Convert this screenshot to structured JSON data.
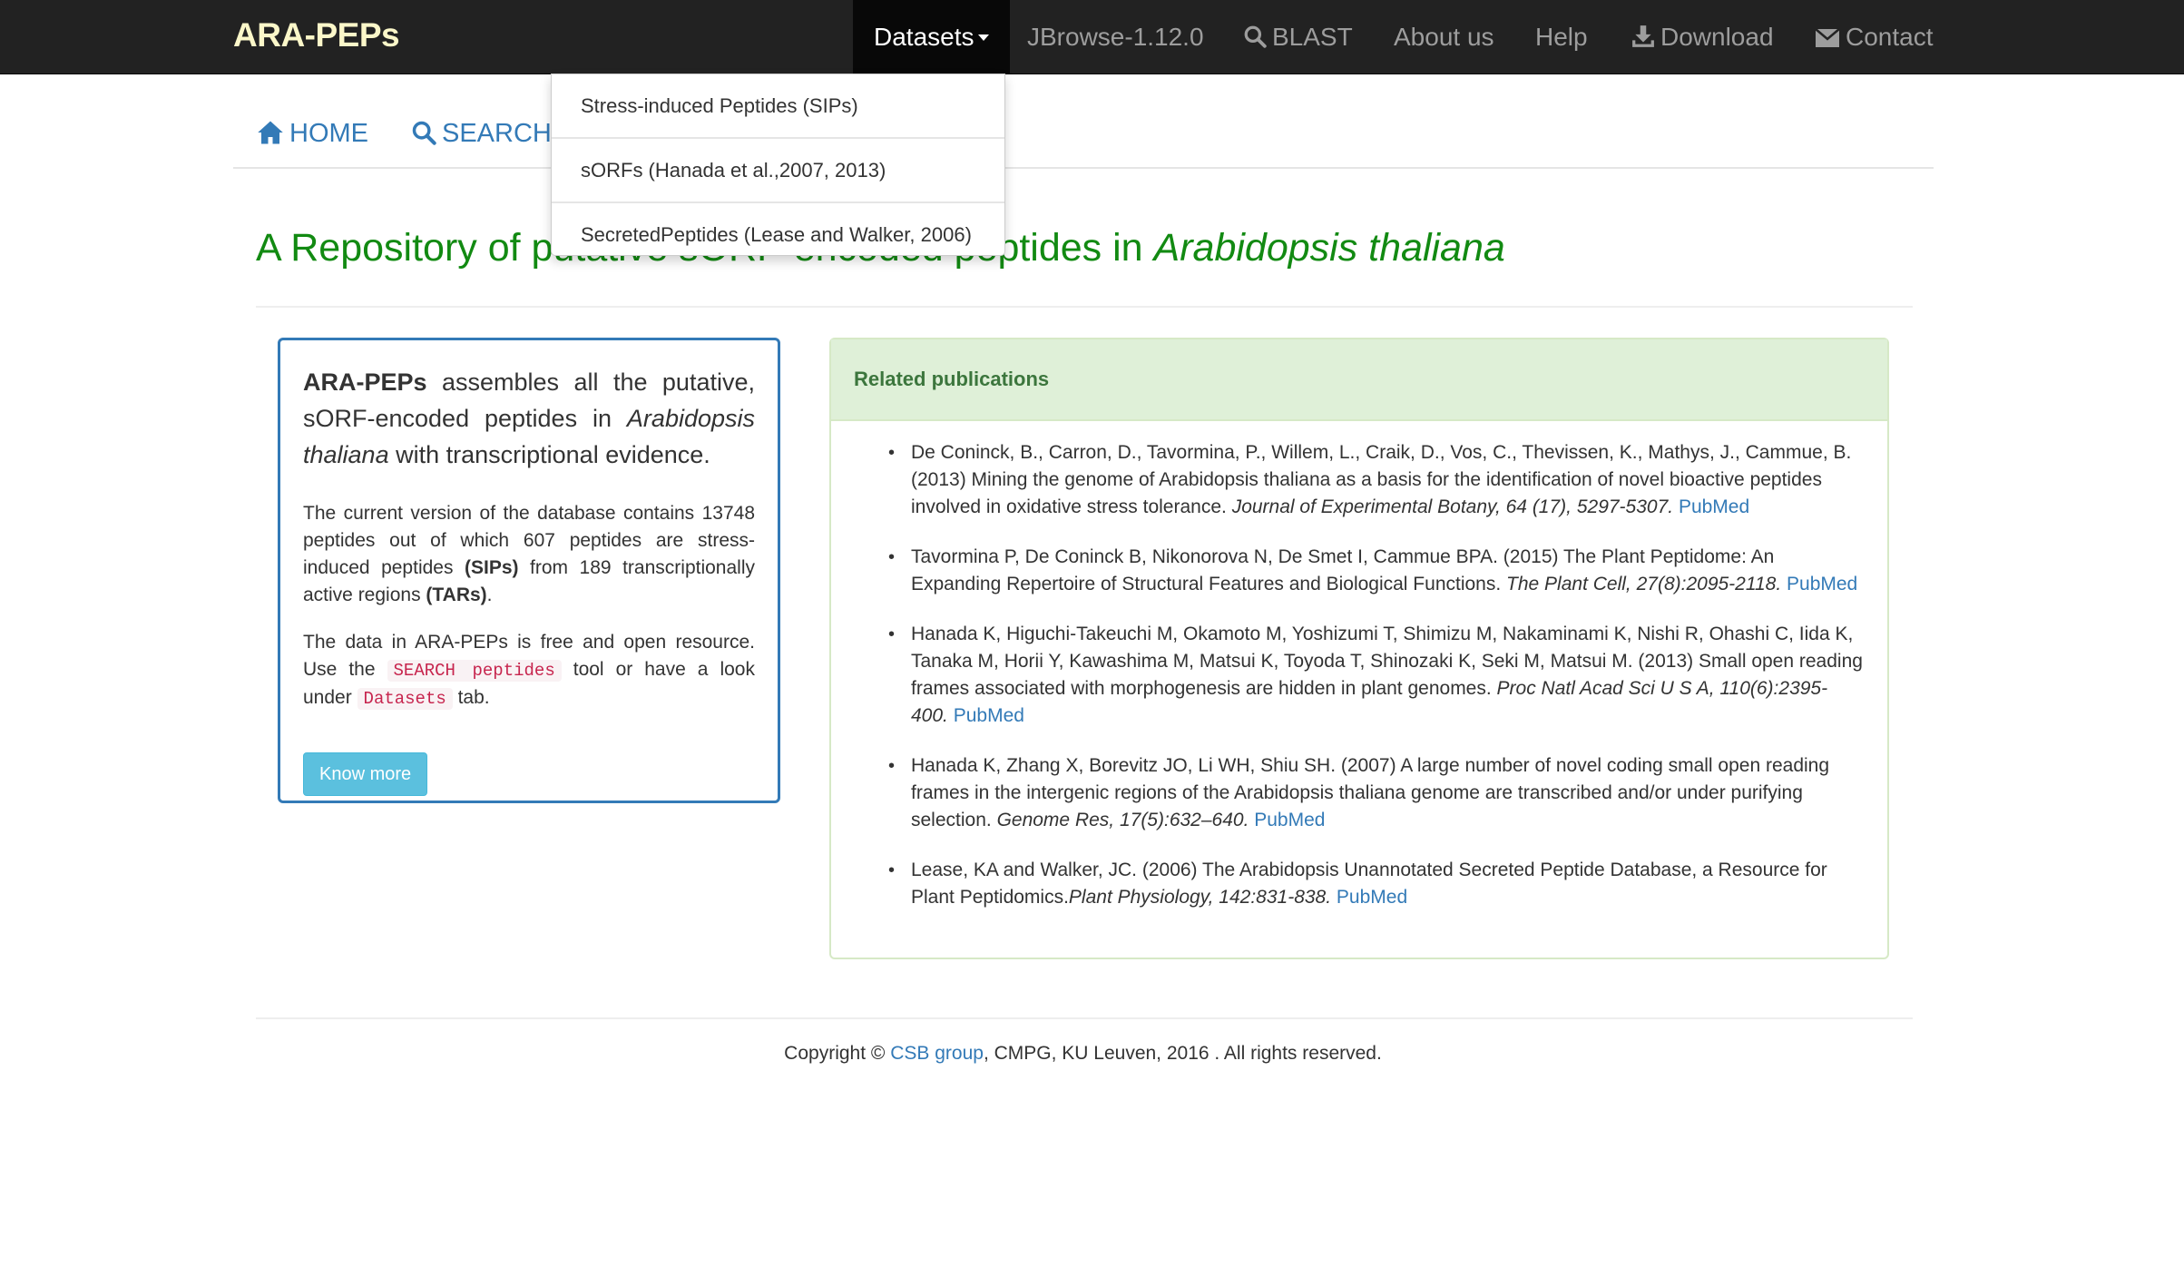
{
  "navbar": {
    "brand": "ARA-PEPs",
    "datasets": "Datasets",
    "jbrowse": "JBrowse-1.12.0",
    "blast": "BLAST",
    "about": "About us",
    "help": "Help",
    "download": "Download",
    "contact": "Contact"
  },
  "dropdown": {
    "items": [
      "Stress-induced Peptides (SIPs)",
      "sORFs (Hanada et al.,2007, 2013)",
      "SecretedPeptides (Lease and Walker, 2006)"
    ]
  },
  "subnav": {
    "home": "HOME",
    "search": "SEARCH"
  },
  "heading": {
    "prefix": "A Repository of putative sORF-encoded peptides in ",
    "species": "Arabidopsis thaliana"
  },
  "intro": {
    "brand": "ARA-PEPs",
    "lead_1": " assembles all the putative, sORF-encoded peptides in ",
    "lead_species": "Arabidopsis thaliana",
    "lead_2": " with transcriptional evidence.",
    "p1_a": "The current version of the database contains 13748 peptides out of which 607 peptides are stress-induced peptides ",
    "p1_sips": "(SIPs)",
    "p1_b": " from 189 transcriptionally active regions ",
    "p1_tars": "(TARs)",
    "p1_c": ".",
    "p2_a": "The data in ARA-PEPs is free and open resource. Use the ",
    "p2_code1": "SEARCH peptides",
    "p2_b": " tool or have a look under ",
    "p2_code2": "Datasets",
    "p2_c": " tab.",
    "button": "Know more"
  },
  "publications": {
    "title": "Related publications",
    "items": [
      {
        "text": "De Coninck, B., Carron, D., Tavormina, P., Willem, L., Craik, D., Vos, C., Thevissen, K., Mathys, J., Cammue, B. (2013) Mining the genome of Arabidopsis thaliana as a basis for the identification of novel bioactive peptides involved in oxidative stress tolerance. ",
        "journal": "Journal of Experimental Botany, 64 (17), 5297-5307.",
        "link": "PubMed"
      },
      {
        "text": "Tavormina P, De Coninck B, Nikonorova N, De Smet I, Cammue BPA. (2015) The Plant Peptidome: An Expanding Repertoire of Structural Features and Biological Functions. ",
        "journal": "The Plant Cell, 27(8):2095-2118.",
        "link": "PubMed"
      },
      {
        "text": "Hanada K, Higuchi-Takeuchi M, Okamoto M, Yoshizumi T, Shimizu M, Nakaminami K, Nishi R, Ohashi C, Iida K, Tanaka M, Horii Y, Kawashima M, Matsui K, Toyoda T, Shinozaki K, Seki M, Matsui M. (2013) Small open reading frames associated with morphogenesis are hidden in plant genomes. ",
        "journal": "Proc Natl Acad Sci U S A, 110(6):2395-400.",
        "link": "PubMed"
      },
      {
        "text": "Hanada K, Zhang X, Borevitz JO, Li WH, Shiu SH. (2007) A large number of novel coding small open reading frames in the intergenic regions of the Arabidopsis thaliana genome are transcribed and/or under purifying selection. ",
        "journal": "Genome Res, 17(5):632–640.",
        "link": "PubMed"
      },
      {
        "text": "Lease, KA and Walker, JC. (2006) The Arabidopsis Unannotated Secreted Peptide Database, a Resource for Plant Peptidomics.",
        "journal": "Plant Physiology, 142:831-838.",
        "link": "PubMed"
      }
    ]
  },
  "footer": {
    "prefix": "Copyright © ",
    "link": "CSB group",
    "suffix": ", CMPG, KU Leuven, 2016 . All rights reserved."
  },
  "colors": {
    "navbar": "#222222",
    "brand": "#fbf7c9",
    "heading": "#128a12",
    "link": "#337ab7",
    "panel_heading": "#dff0d8"
  }
}
